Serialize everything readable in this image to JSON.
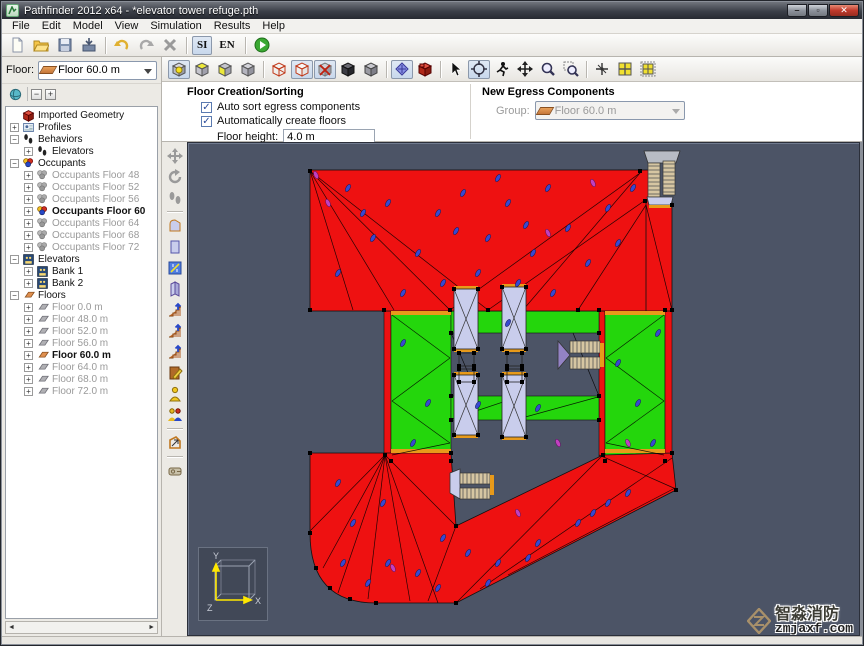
{
  "window": {
    "title": "Pathfinder 2012 x64 - *elevator tower refuge.pth",
    "controls": {
      "minimize": "—",
      "maximize": "▢",
      "close": "✕"
    }
  },
  "menu": {
    "items": [
      "File",
      "Edit",
      "Model",
      "View",
      "Simulation",
      "Results",
      "Help"
    ]
  },
  "toolbar_main": {
    "buttons": [
      {
        "name": "new-file-button",
        "icon": "doc-icon"
      },
      {
        "name": "open-file-button",
        "icon": "folder-icon"
      },
      {
        "name": "save-file-button",
        "icon": "save-icon"
      },
      {
        "name": "import-button",
        "icon": "import-icon"
      },
      {
        "sep": true
      },
      {
        "name": "undo-button",
        "icon": "undo-icon"
      },
      {
        "name": "redo-button",
        "icon": "redo-icon"
      },
      {
        "name": "delete-button",
        "icon": "delete-icon"
      },
      {
        "sep": true
      },
      {
        "name": "units-si-button",
        "label": "SI",
        "pressed": true
      },
      {
        "name": "units-en-button",
        "label": "EN"
      },
      {
        "sep": true
      },
      {
        "name": "run-simulation-button",
        "icon": "run-icon"
      }
    ]
  },
  "floor_selector": {
    "label": "Floor:",
    "value": "Floor 60.0 m"
  },
  "tree_toolbar": {
    "buttons": [
      {
        "name": "refresh-view-button",
        "icon": "orbit-sphere-icon"
      },
      {
        "sep": true
      },
      {
        "name": "collapse-all-button",
        "label": "−"
      },
      {
        "name": "expand-all-button",
        "label": "+"
      }
    ]
  },
  "tree": {
    "items": [
      {
        "label": "Imported Geometry",
        "icon": "geometry-icon",
        "level": 0,
        "expander": null
      },
      {
        "label": "Profiles",
        "icon": "profiles-icon",
        "level": 0,
        "expander": "plus"
      },
      {
        "label": "Behaviors",
        "icon": "footprints-icon",
        "level": 0,
        "expander": "minus"
      },
      {
        "label": "Elevators",
        "icon": "footprints-icon",
        "level": 1,
        "expander": "plus"
      },
      {
        "label": "Occupants",
        "icon": "occupants-icon",
        "level": 0,
        "expander": "minus"
      },
      {
        "label": "Occupants Floor 48",
        "icon": "occupants-gray-icon",
        "level": 1,
        "expander": "plus",
        "gray": true
      },
      {
        "label": "Occupants Floor 52",
        "icon": "occupants-gray-icon",
        "level": 1,
        "expander": "plus",
        "gray": true
      },
      {
        "label": "Occupants Floor 56",
        "icon": "occupants-gray-icon",
        "level": 1,
        "expander": "plus",
        "gray": true
      },
      {
        "label": "Occupants Floor 60",
        "icon": "occupants-icon",
        "level": 1,
        "expander": "plus",
        "bold": true
      },
      {
        "label": "Occupants Floor 64",
        "icon": "occupants-gray-icon",
        "level": 1,
        "expander": "plus",
        "gray": true
      },
      {
        "label": "Occupants Floor 68",
        "icon": "occupants-gray-icon",
        "level": 1,
        "expander": "plus",
        "gray": true
      },
      {
        "label": "Occupants Floor 72",
        "icon": "occupants-gray-icon",
        "level": 1,
        "expander": "plus",
        "gray": true
      },
      {
        "label": "Elevators",
        "icon": "elevator-icon",
        "level": 0,
        "expander": "minus"
      },
      {
        "label": "Bank 1",
        "icon": "elevator-icon",
        "level": 1,
        "expander": "plus"
      },
      {
        "label": "Bank 2",
        "icon": "elevator-icon",
        "level": 1,
        "expander": "plus"
      },
      {
        "label": "Floors",
        "icon": "floor-orange-icon",
        "level": 0,
        "expander": "minus"
      },
      {
        "label": "Floor 0.0 m",
        "icon": "floor-gray-icon",
        "level": 1,
        "expander": "plus",
        "gray": true
      },
      {
        "label": "Floor 48.0 m",
        "icon": "floor-gray-icon",
        "level": 1,
        "expander": "plus",
        "gray": true
      },
      {
        "label": "Floor 52.0 m",
        "icon": "floor-gray-icon",
        "level": 1,
        "expander": "plus",
        "gray": true
      },
      {
        "label": "Floor 56.0 m",
        "icon": "floor-gray-icon",
        "level": 1,
        "expander": "plus",
        "gray": true
      },
      {
        "label": "Floor 60.0 m",
        "icon": "floor-orange-icon",
        "level": 1,
        "expander": "plus",
        "bold": true
      },
      {
        "label": "Floor 64.0 m",
        "icon": "floor-gray-icon",
        "level": 1,
        "expander": "plus",
        "gray": true
      },
      {
        "label": "Floor 68.0 m",
        "icon": "floor-gray-icon",
        "level": 1,
        "expander": "plus",
        "gray": true
      },
      {
        "label": "Floor 72.0 m",
        "icon": "floor-gray-icon",
        "level": 1,
        "expander": "plus",
        "gray": true
      }
    ]
  },
  "panels": {
    "floor_creation": {
      "title": "Floor Creation/Sorting",
      "checkbox1": "Auto sort egress components",
      "checkbox1_checked": true,
      "checkbox2": "Automatically create floors",
      "checkbox2_checked": true,
      "floor_height_label": "Floor height:",
      "floor_height_value": "4.0 m"
    },
    "new_egress": {
      "title": "New Egress Components",
      "group_label": "Group:",
      "group_value": "Floor 60.0 m"
    }
  },
  "view_toolbar": {
    "buttons": [
      {
        "name": "view-perspective-button",
        "icon": "cube-dot-icon",
        "pressed": true
      },
      {
        "name": "view-top-button",
        "icon": "cube-top-icon"
      },
      {
        "name": "view-front-button",
        "icon": "cube-front-icon"
      },
      {
        "name": "view-side-button",
        "icon": "cube-plain-icon"
      },
      {
        "sep": true
      },
      {
        "name": "wireframe-mode-button",
        "icon": "cube-wire-icon"
      },
      {
        "name": "outline-mode-button",
        "icon": "cube-outline-icon",
        "pressed": true
      },
      {
        "name": "transparent-mode-button",
        "icon": "cube-x-icon",
        "pressed": true
      },
      {
        "name": "solid-dark-mode-button",
        "icon": "cube-dark-icon"
      },
      {
        "name": "solid-mode-button",
        "icon": "cube-mid-icon"
      },
      {
        "sep": true
      },
      {
        "name": "show-navmesh-button",
        "icon": "navmesh-icon",
        "pressed": true
      },
      {
        "name": "show-imported-geometry-button",
        "icon": "bricks-icon"
      },
      {
        "sep": true
      },
      {
        "name": "select-tool-button",
        "icon": "cursor-icon"
      },
      {
        "name": "orbit-tool-button",
        "icon": "orbit-icon",
        "pressed": true
      },
      {
        "name": "walk-tool-button",
        "icon": "runner-icon"
      },
      {
        "name": "pan-tool-button",
        "icon": "move-arrows-icon"
      },
      {
        "name": "zoom-tool-button",
        "icon": "magnifier-icon"
      },
      {
        "name": "zoom-box-tool-button",
        "icon": "magnifier-box-icon"
      },
      {
        "sep": true
      },
      {
        "name": "snap-point-button",
        "icon": "snap-cross-icon"
      },
      {
        "name": "snap-grid-button",
        "icon": "grid-yellow-icon"
      },
      {
        "name": "grid-settings-button",
        "icon": "grid-box-icon"
      }
    ]
  },
  "draw_toolbar": {
    "buttons": [
      {
        "name": "move-objects-tool",
        "icon": "move-gray-icon",
        "disabled": true
      },
      {
        "name": "rotate-objects-tool",
        "icon": "rotate-gray-icon",
        "disabled": true
      },
      {
        "name": "occupant-path-tool",
        "icon": "feet-gray-icon",
        "disabled": true
      },
      {
        "sep": true
      },
      {
        "name": "polygon-room-tool",
        "icon": "polygon-room-icon"
      },
      {
        "name": "rectangle-room-tool",
        "icon": "rect-room-icon"
      },
      {
        "name": "thin-room-tool",
        "icon": "thin-room-icon"
      },
      {
        "name": "door-tool",
        "icon": "prism-icon"
      },
      {
        "name": "stairs-tool",
        "icon": "stairs-icon"
      },
      {
        "name": "stairs-landing-tool",
        "icon": "stairs-icon"
      },
      {
        "name": "ramp-tool",
        "icon": "stairs-icon"
      },
      {
        "name": "elevator-tool",
        "icon": "door-edit-icon"
      },
      {
        "name": "add-occupant-tool",
        "icon": "person-icon"
      },
      {
        "name": "add-occupant-group-tool",
        "icon": "persons-icon"
      },
      {
        "sep": true
      },
      {
        "name": "measure-region-tool",
        "icon": "measure-icon"
      },
      {
        "sep": true
      },
      {
        "name": "tape-measure-tool",
        "icon": "tape-icon"
      }
    ]
  },
  "canvas": {
    "axis": {
      "x": "X",
      "y": "Y",
      "z": "Z"
    },
    "watermark": {
      "line1": "智淼消防",
      "line2": "zmjaxf.com"
    }
  },
  "colors": {
    "room_red": "#ee1111",
    "corridor_green": "#24d60c",
    "canvas_bg": "#4c5466",
    "shaft_lavender": "#c9cdec",
    "door_orange": "#e89a1a",
    "occupant_blue": "#3848d0",
    "occupant_magenta": "#c040c0",
    "axis_yellow": "#ffe800"
  }
}
